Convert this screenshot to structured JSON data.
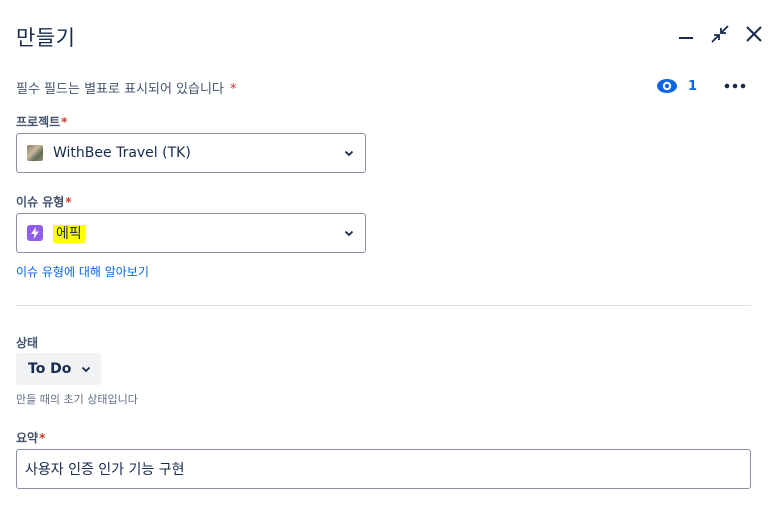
{
  "header": {
    "title": "만들기"
  },
  "form": {
    "required_note": "필수 필드는 별표로 표시되어 있습니다",
    "required_star": "*",
    "watchers_count": "1",
    "project": {
      "label": "프로젝트",
      "value": "WithBee Travel (TK)"
    },
    "issue_type": {
      "label": "이슈 유형",
      "value": "에픽",
      "learn_more": "이슈 유형에 대해 알아보기"
    },
    "status": {
      "label": "상태",
      "value": "To Do",
      "helper": "만들 때의 초기 상태입니다"
    },
    "summary": {
      "label": "요약",
      "value": "사용자 인증 인가 기능 구현"
    }
  },
  "icons": {
    "minimize": "minimize-icon",
    "collapse": "collapse-icon",
    "close": "close-icon",
    "watch": "eye-icon",
    "more": "more-icon",
    "epic": "epic-lightning-icon"
  },
  "colors": {
    "link": "#0c66e4",
    "required": "#c9372c",
    "epic": "#8f5fe8",
    "highlight": "#ffff00"
  }
}
